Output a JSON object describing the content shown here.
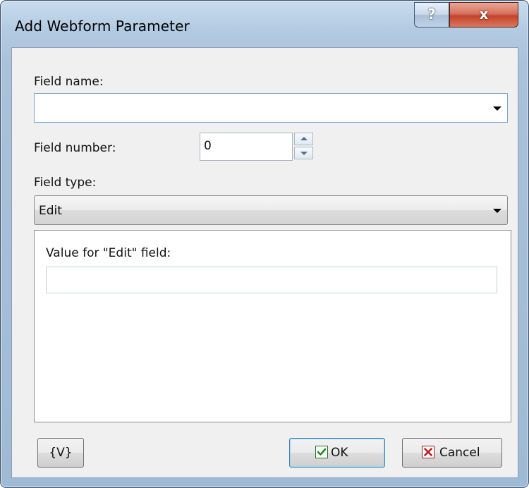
{
  "window": {
    "title": "Add Webform Parameter",
    "help_label": "?",
    "close_label": "x"
  },
  "form": {
    "field_name_label": "Field name:",
    "field_name_value": "",
    "field_number_label": "Field number:",
    "field_number_value": "0",
    "field_type_label": "Field type:",
    "field_type_value": "Edit",
    "value_label": "Value for \"Edit\" field:",
    "value_value": ""
  },
  "buttons": {
    "variables_label": "{V}",
    "ok_label": "OK",
    "cancel_label": "Cancel"
  },
  "icons": {
    "ok": "checkmark-icon",
    "cancel": "x-mark-icon",
    "dropdown": "chevron-down-icon"
  },
  "colors": {
    "ok_check": "#1f8a1f",
    "cancel_x": "#c01818",
    "close_button": "#c3442a"
  }
}
